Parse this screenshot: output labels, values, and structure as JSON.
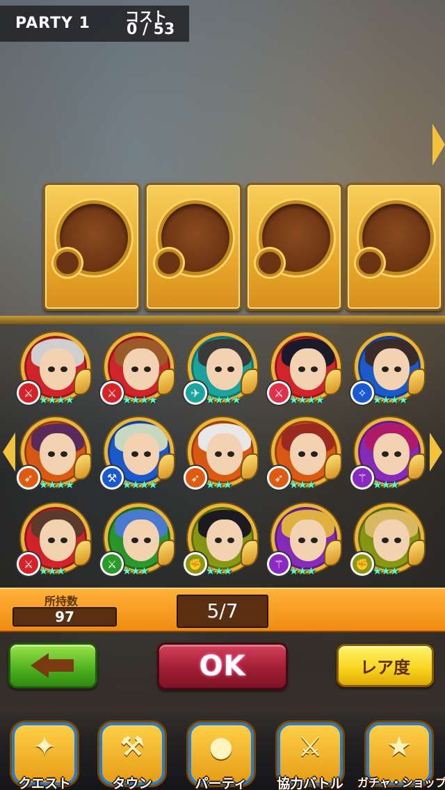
{
  "header": {
    "party_title": "PARTY 1",
    "cost_label": "コスト",
    "cost_value": "0 / 53"
  },
  "party_slots": [
    {
      "state": "empty"
    },
    {
      "state": "empty"
    },
    {
      "state": "empty"
    },
    {
      "state": "empty"
    }
  ],
  "characters": [
    {
      "element": "sword",
      "element_color": "#d8222a",
      "stars": "★★★★",
      "hair_color": "#cfcfcf",
      "ring_color": "#d8222a"
    },
    {
      "element": "sword",
      "element_color": "#d8222a",
      "stars": "★★★★",
      "hair_color": "#9a5a2a",
      "ring_color": "#d8222a"
    },
    {
      "element": "wind",
      "element_color": "#1aa6a0",
      "stars": "★★★★",
      "hair_color": "#3a3a3a",
      "ring_color": "#1aa6a0"
    },
    {
      "element": "sword",
      "element_color": "#e0304a",
      "stars": "★★★★",
      "hair_color": "#1a1a2a",
      "ring_color": "#d8222a"
    },
    {
      "element": "magic",
      "element_color": "#1a5ad0",
      "stars": "★★★★",
      "hair_color": "#3a2a2a",
      "ring_color": "#1a5ad0"
    },
    {
      "element": "bow",
      "element_color": "#e05a10",
      "stars": "★★★★",
      "hair_color": "#5a2a5a",
      "ring_color": "#e05a10"
    },
    {
      "element": "axe",
      "element_color": "#1a5ad0",
      "stars": "★★★★",
      "hair_color": "#c8d8c0",
      "ring_color": "#1a5ad0"
    },
    {
      "element": "bow",
      "element_color": "#e05a10",
      "stars": "★★★",
      "hair_color": "#e8e8e8",
      "ring_color": "#e05a10"
    },
    {
      "element": "bow",
      "element_color": "#e05a10",
      "stars": "★★★",
      "hair_color": "#9a2a20",
      "ring_color": "#e05a10"
    },
    {
      "element": "staff",
      "element_color": "#8a2ac0",
      "stars": "★★★",
      "hair_color": "#b01a6a",
      "ring_color": "#8a2ac0"
    },
    {
      "element": "sword",
      "element_color": "#d8222a",
      "stars": "★★★",
      "hair_color": "#5a3a2a",
      "ring_color": "#d8222a"
    },
    {
      "element": "sword",
      "element_color": "#2a9a2a",
      "stars": "★★★",
      "hair_color": "#4a7ad0",
      "ring_color": "#2a9a2a"
    },
    {
      "element": "fist",
      "element_color": "#8a9a10",
      "stars": "★★★",
      "hair_color": "#1a1a20",
      "ring_color": "#8a9a10"
    },
    {
      "element": "staff",
      "element_color": "#8a2ac0",
      "stars": "★★★",
      "hair_color": "#e0b040",
      "ring_color": "#8a2ac0"
    },
    {
      "element": "fist",
      "element_color": "#8a9a10",
      "stars": "★★★",
      "hair_color": "#d8b860",
      "ring_color": "#8a9a10"
    }
  ],
  "counts": {
    "owned_label": "所持数",
    "owned_value": "97",
    "page": "5/7"
  },
  "actions": {
    "ok_label": "OK",
    "rarity_label": "レア度"
  },
  "nav": {
    "items": [
      {
        "label": "クエスト",
        "icon": "quest-map-icon",
        "glyph": "✦"
      },
      {
        "label": "タウン",
        "icon": "town-icon",
        "glyph": "⚒"
      },
      {
        "label": "パーティ",
        "icon": "party-icon",
        "glyph": "●"
      },
      {
        "label": "協力バトル",
        "icon": "coop-battle-icon",
        "glyph": "⚔"
      },
      {
        "label": "ガチャ・ショップ",
        "icon": "gacha-shop-icon",
        "glyph": "★"
      }
    ]
  }
}
